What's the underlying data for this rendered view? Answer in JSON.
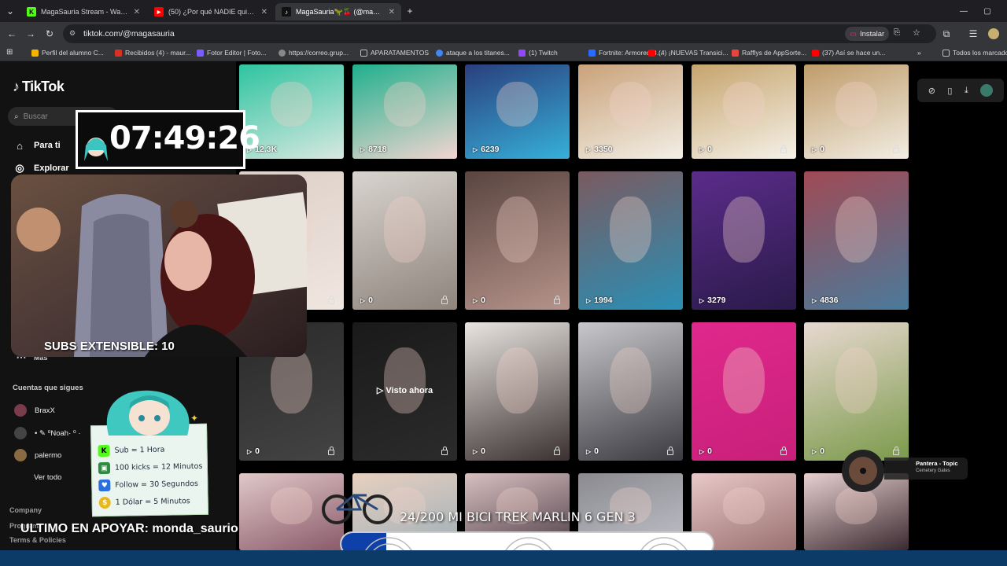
{
  "browser": {
    "tabs": [
      {
        "title": "MagaSauria Stream - Watch Li...",
        "favicon": "kick-icon",
        "color": "#53fc18",
        "letter": "K"
      },
      {
        "title": "(50) ¿Por qué NADIE quiere a e...",
        "favicon": "youtube-icon",
        "color": "#ff0000",
        "letter": "▶"
      },
      {
        "title": "MagaSauria🦖🍒 (@magasaur...",
        "favicon": "tiktok-icon",
        "color": "#111111",
        "letter": "♪"
      }
    ],
    "new_tab": "+",
    "url": "tiktok.com/@magasauria",
    "install_label": "Instalar",
    "bookmarks": [
      {
        "label": "Perfil del alumno C...",
        "color": "#f4b400"
      },
      {
        "label": "Recibidos (4) - maur...",
        "color": "#d93025"
      },
      {
        "label": "Fotor Editor | Foto...",
        "color": "#7b5cff"
      },
      {
        "label": "https://correo.grup...",
        "color": "#888888"
      },
      {
        "label": "APARATAMENTOS",
        "color": "#bbbbbb"
      },
      {
        "label": "ataque a los titanes...",
        "color": "#4285f4"
      },
      {
        "label": "(1) Twitch",
        "color": "#9146ff"
      },
      {
        "label": "Fortnite: Armored B...",
        "color": "#2a6bff"
      },
      {
        "label": "(4) ¡NUEVAS Transici...",
        "color": "#ff0000"
      },
      {
        "label": "Rafflys de AppSorte...",
        "color": "#e8453c"
      },
      {
        "label": "(37) Así se hace un...",
        "color": "#ff0000"
      }
    ],
    "all_bookmarks": "Todos los marcado"
  },
  "tiktok": {
    "logo": "TikTok",
    "search_placeholder": "Buscar",
    "nav": [
      {
        "label": "Para ti",
        "icon": "home-icon"
      },
      {
        "label": "Explorar",
        "icon": "compass-icon"
      }
    ],
    "more_label": "Más",
    "following_title": "Cuentas que sigues",
    "following": [
      {
        "name": "BraxX",
        "color": "#7a3b4a"
      },
      {
        "name": "• ✎ ⁰Noah· ⁰ ·",
        "color": "#444444"
      },
      {
        "name": "palermo",
        "color": "#8a6a40"
      }
    ],
    "see_all": "Ver todo",
    "footer": [
      "Company",
      "Program",
      "Terms & Policies"
    ]
  },
  "grid": {
    "rows": [
      [
        {
          "views": "12.3K",
          "locked": false,
          "colors": [
            "#2ec4a0",
            "#d7e8e0"
          ]
        },
        {
          "views": "8718",
          "locked": false,
          "colors": [
            "#1fb08d",
            "#f2d5d0"
          ]
        },
        {
          "views": "6239",
          "locked": false,
          "colors": [
            "#2a3f7d",
            "#36b0d9"
          ]
        },
        {
          "views": "3350",
          "locked": false,
          "colors": [
            "#c9a27a",
            "#f3efe6"
          ]
        },
        {
          "views": "0",
          "locked": true,
          "colors": [
            "#c6a46d",
            "#f5f1e8"
          ]
        },
        {
          "views": "0",
          "locked": true,
          "colors": [
            "#bf9c6a",
            "#f2ede3"
          ]
        }
      ],
      [
        {
          "views": "",
          "locked": true,
          "colors": [
            "#ddd0c8",
            "#f0e6e0"
          ]
        },
        {
          "views": "0",
          "locked": true,
          "colors": [
            "#d9d4cf",
            "#8e847c"
          ]
        },
        {
          "views": "0",
          "locked": true,
          "colors": [
            "#5a4540",
            "#b5938a"
          ]
        },
        {
          "views": "1994",
          "locked": false,
          "colors": [
            "#7a5a60",
            "#2a8fb5"
          ]
        },
        {
          "views": "3279",
          "locked": false,
          "colors": [
            "#5b2c8a",
            "#2a1a4a"
          ]
        },
        {
          "views": "4836",
          "locked": false,
          "colors": [
            "#a04a55",
            "#4a7a9a"
          ]
        }
      ],
      [
        {
          "views": "0",
          "locked": true,
          "colors": [
            "#2a2a2a",
            "#444444"
          ]
        },
        {
          "views": "",
          "locked": true,
          "visto": "Visto ahora",
          "colors": [
            "#1a1a1a",
            "#2b2b2b"
          ]
        },
        {
          "views": "0",
          "locked": true,
          "colors": [
            "#e8e4e0",
            "#3a3030"
          ]
        },
        {
          "views": "0",
          "locked": true,
          "colors": [
            "#c8c8cc",
            "#3a3a40"
          ]
        },
        {
          "views": "0",
          "locked": true,
          "colors": [
            "#e0288c",
            "#c8207a"
          ]
        },
        {
          "views": "0",
          "locked": true,
          "colors": [
            "#e8d8d0",
            "#7a9a4a"
          ]
        }
      ],
      [
        {
          "views": "",
          "locked": false,
          "colors": [
            "#e0c8c8",
            "#8a5a6a"
          ]
        },
        {
          "views": "",
          "locked": false,
          "colors": [
            "#e8d0c0",
            "#a0b0b8"
          ]
        },
        {
          "views": "",
          "locked": false,
          "colors": [
            "#d8c0c0",
            "#50404a"
          ]
        },
        {
          "views": "",
          "locked": false,
          "colors": [
            "#8a8a90",
            "#c0c0c8"
          ]
        },
        {
          "views": "",
          "locked": false,
          "colors": [
            "#e8c8c8",
            "#9a7070"
          ]
        },
        {
          "views": "",
          "locked": false,
          "colors": [
            "#e8d0d0",
            "#3a2a30"
          ]
        }
      ]
    ]
  },
  "overlay": {
    "timer": "07:49:26",
    "subs_extensible": "SUBS EXTENSIBLE: 10",
    "card": [
      {
        "icon": "K",
        "color": "#53fc18",
        "text": "Sub = 1 Hora"
      },
      {
        "icon": "▣",
        "color": "#2d8a3e",
        "text": "100 kicks = 12 Minutos"
      },
      {
        "icon": "♥",
        "color": "#2a6fe0",
        "text": "Follow = 30 Segundos"
      },
      {
        "icon": "$",
        "color": "#e8b820",
        "text": "1 Dólar = 5 Minutos"
      }
    ],
    "last_support": "ULTIMO EN APOYAR: monda_saurio",
    "goal": "24/200 MI BICI TREK MARLIN 6 GEN 3",
    "goal_progress": 0.12,
    "music_title": "Pantera - Topic",
    "music_subtitle": "Cemetery Gates"
  }
}
